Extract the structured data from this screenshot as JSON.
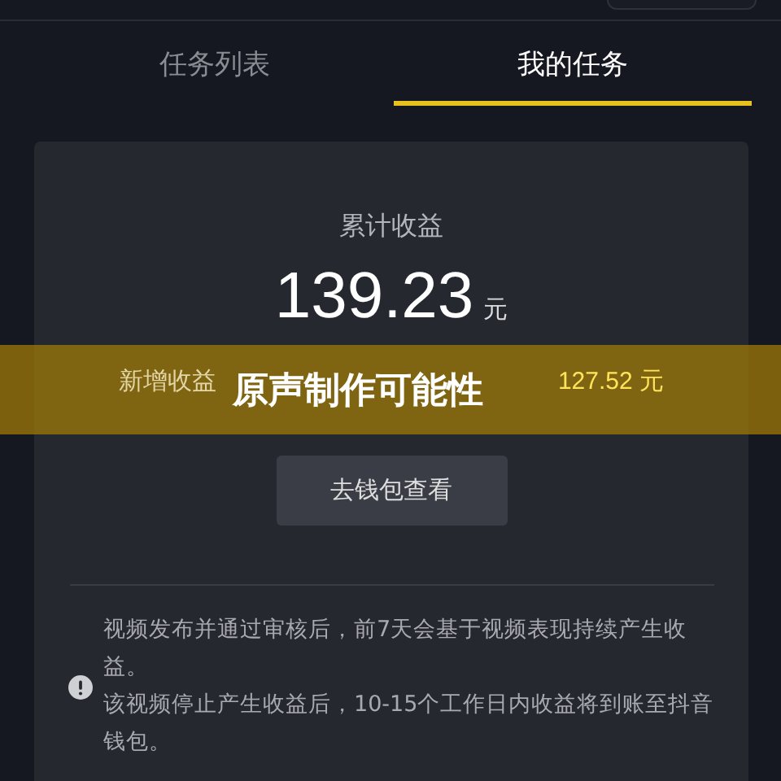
{
  "tabs": [
    {
      "label": "任务列表",
      "selected": false
    },
    {
      "label": "我的任务",
      "selected": true
    }
  ],
  "earnings": {
    "label": "累计收益",
    "amount": "139.23",
    "unit": "元"
  },
  "new_earnings": {
    "label": "新增收益",
    "amount": "127.52",
    "unit": "元"
  },
  "wallet_button": "去钱包查看",
  "notes": [
    "视频发布并通过审核后，前7天会基于视频表现持续产生收益。",
    "该视频停止产生收益后，10-15个工作日内收益将到账至抖音钱包。"
  ],
  "banner": "原声制作可能性"
}
